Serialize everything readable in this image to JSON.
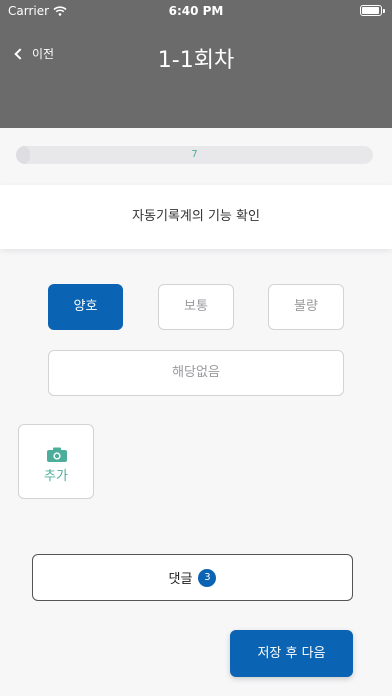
{
  "status_bar": {
    "carrier": "Carrier",
    "time": "6:40 PM"
  },
  "nav": {
    "back_label": "이전",
    "title": "1-1회차"
  },
  "progress": {
    "label": "7",
    "fraction": 0.04
  },
  "question": {
    "text": "자동기록계의 기능 확인"
  },
  "options": {
    "good": "양호",
    "normal": "보통",
    "bad": "불량",
    "not_applicable": "해당없음",
    "selected": "good"
  },
  "photo": {
    "add_label": "추가",
    "icon": "camera-icon"
  },
  "comments": {
    "label": "댓글",
    "count": "3"
  },
  "actions": {
    "save_next_label": "저장 후 다음"
  },
  "colors": {
    "header_bg": "#6b6b6b",
    "accent_blue": "#0b64b3",
    "accent_green": "#4cae9a",
    "page_bg": "#f7f7f8"
  }
}
